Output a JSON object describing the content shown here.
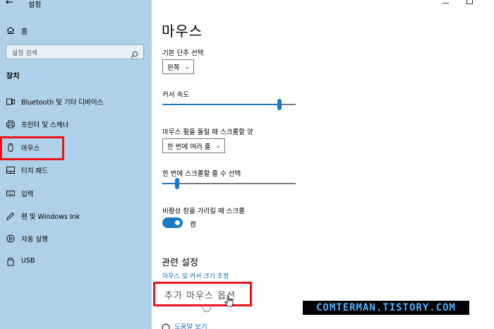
{
  "window": {
    "app_title": "설정"
  },
  "sidebar": {
    "home_label": "홈",
    "search_placeholder": "설정 검색",
    "section_label": "장치",
    "items": [
      {
        "label": "Bluetooth 및 기타 디바이스",
        "icon": "bluetooth-devices-icon"
      },
      {
        "label": "프린터 및 스캐너",
        "icon": "printer-icon"
      },
      {
        "label": "마우스",
        "icon": "mouse-icon"
      },
      {
        "label": "터치 패드",
        "icon": "touchpad-icon"
      },
      {
        "label": "입력",
        "icon": "keyboard-icon"
      },
      {
        "label": "펜 및 Windows Ink",
        "icon": "pen-icon"
      },
      {
        "label": "자동 실행",
        "icon": "autoplay-icon"
      },
      {
        "label": "USB",
        "icon": "usb-icon"
      }
    ],
    "selected": "마우스"
  },
  "main": {
    "title": "마우스",
    "primary_button": {
      "label": "기본 단추 선택",
      "value": "왼쪽"
    },
    "cursor_speed": {
      "label": "커서 속도",
      "level": 0.88
    },
    "wheel_scroll": {
      "label": "마우스 휠을 돌릴 때 스크롤할 양",
      "value": "한 번에 여러 줄"
    },
    "lines_to_scroll": {
      "label": "한 번에 스크롤할 줄 수 선택",
      "level": 0.11
    },
    "inactive_scroll": {
      "label": "비활성 창을 가리킬 때 스크롤",
      "state": "켬",
      "on": true
    },
    "related": {
      "title": "관련 설정",
      "link1": "마우스 및 커서 크기 조정",
      "link2": "추가 마우스 옵션"
    },
    "help_link": "도움말 보기"
  },
  "watermark": "COMTERMAN.TISTORY.COM",
  "colors": {
    "sidebar_bg": "#aed0e9",
    "accent": "#1a7ac6",
    "highlight": "#e8141b"
  }
}
